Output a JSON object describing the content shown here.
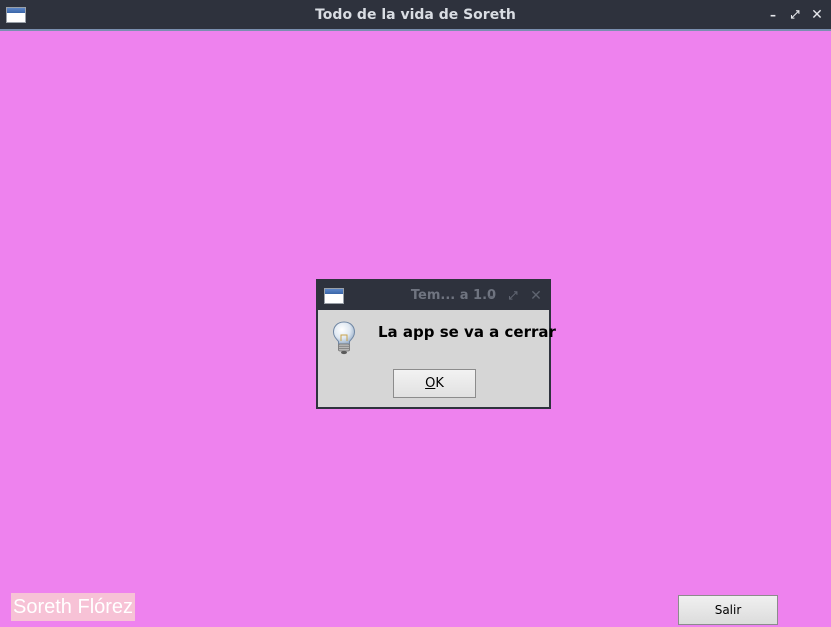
{
  "window": {
    "title": "Todo de la vida de Soreth",
    "controls": {
      "minimize": "–",
      "maximize": "⤢",
      "close": "✕"
    },
    "background_color": "#ee82ee"
  },
  "dialog": {
    "title": "Tem... a 1.0",
    "icon": "lightbulb-icon",
    "message": "La app se va a cerrar",
    "ok_mnemonic": "O",
    "ok_rest": "K",
    "controls": {
      "minimize": "–",
      "maximize": "⤢",
      "close": "✕"
    }
  },
  "footer": {
    "name_label": "Soreth Flórez",
    "exit_label": "Salir"
  }
}
